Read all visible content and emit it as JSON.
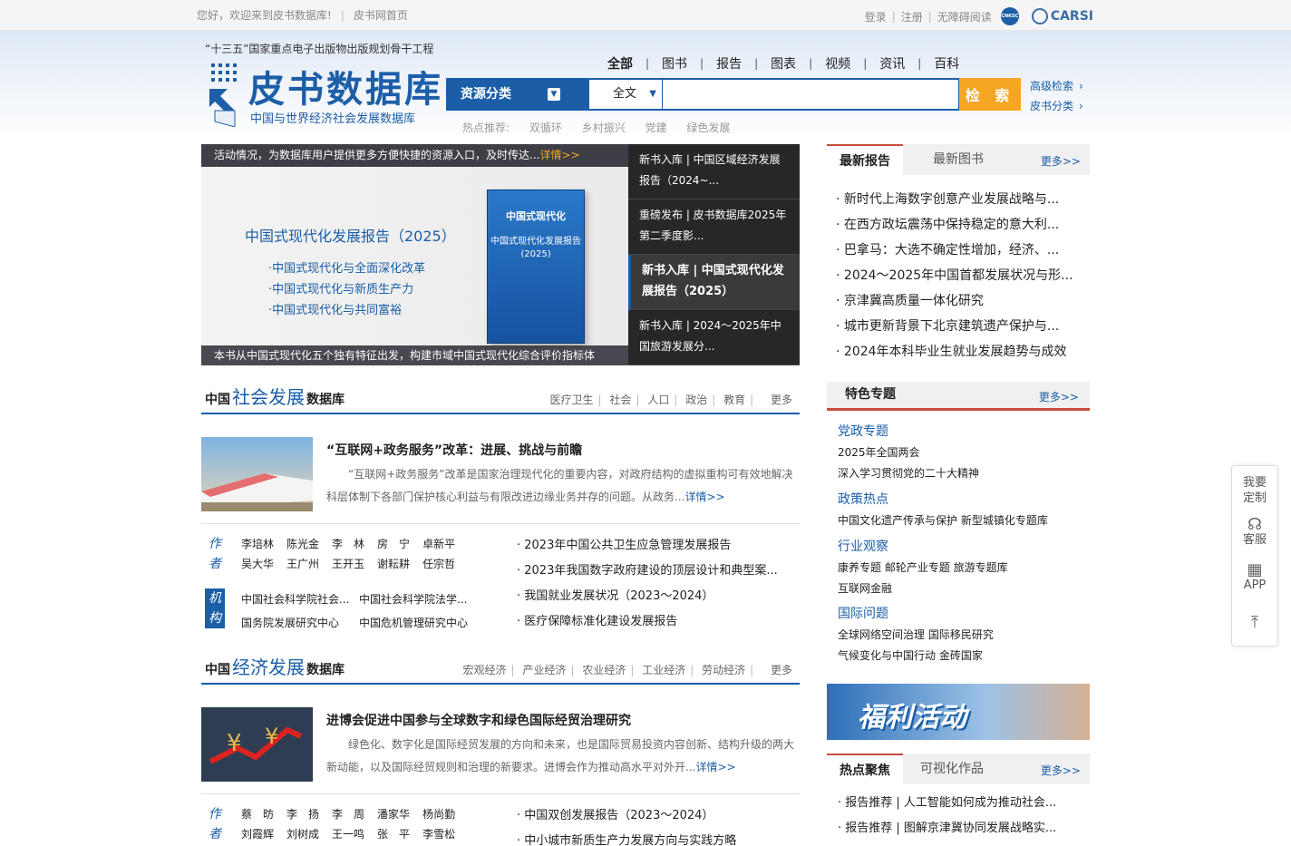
{
  "topbar": {
    "welcome": "您好，欢迎来到皮书数据库!",
    "home_link": "皮书网首页",
    "login": "登录",
    "register": "注册",
    "accessible": "无障碍阅读",
    "carsi_label": "CARSI",
    "circle_logo": "CNKSC"
  },
  "header": {
    "slogan": "“十三五”国家重点电子出版物出版规划骨干工程",
    "logo_title": "皮书数据库",
    "logo_sub": "中国与世界经济社会发展数据库"
  },
  "search": {
    "tabs": [
      "全部",
      "图书",
      "报告",
      "图表",
      "视频",
      "资讯",
      "百科"
    ],
    "active_tab": "全部",
    "category_label": "资源分类",
    "field_value": "全文",
    "input_value": "",
    "button_label": "检 索",
    "advanced": "高级检索",
    "classify": "皮书分类",
    "hot_label": "热点推荐:",
    "hot_keywords": [
      "双循环",
      "乡村振兴",
      "党建",
      "绿色发展"
    ]
  },
  "banner": {
    "top_text": "活动情况，为数据库用户提供更多方便快捷的资源入口，及时传达...",
    "top_more": "详情>>",
    "title": "中国式现代化发展报告（2025）",
    "bullets": [
      "·中国式现代化与全面深化改革",
      "·中国式现代化与新质生产力",
      "·中国式现代化与共同富裕"
    ],
    "book_title": "中国式现代化",
    "book_sub": "中国式现代化发展报告(2025)",
    "bottom_text": "本书从中国式现代化五个独有特征出发，构建市域中国式现代化综合评价指标体"
  },
  "side_news": [
    "新书入库 | 中国区域经济发展报告（2024~...",
    "重磅发布 | 皮书数据库2025年第二季度影...",
    "新书入库 | 中国式现代化发展报告（2025）",
    "新书入库 | 2024～2025年中国旅游发展分..."
  ],
  "social": {
    "title_pre": "中国",
    "title_big": "社会发展",
    "title_post": "数据库",
    "cats": [
      "医疗卫生",
      "社会",
      "人口",
      "政治",
      "教育"
    ],
    "more": "更多",
    "feature_title": "“互联网+政务服务”改革：进展、挑战与前瞻",
    "feature_desc": "“互联网+政务服务”改革是国家治理现代化的重要内容，对政府结构的虚拟重构可有效地解决科层体制下各部门保护核心利益与有限改进边缘业务并存的问题。从政务...",
    "feature_more": "详情>>",
    "author_tag": "作者",
    "authors_row1": [
      "李培林",
      "陈光金",
      "李　林",
      "房　宁",
      "卓新平"
    ],
    "authors_row2": [
      "吴大华",
      "王广州",
      "王开玉",
      "谢耘耕",
      "任宗哲"
    ],
    "org_tag": "机构",
    "orgs_row1": [
      "中国社会科学院社会...",
      "中国社会科学院法学..."
    ],
    "orgs_row2": [
      "国务院发展研究中心",
      "中国危机管理研究中心"
    ],
    "reports": [
      "2023年中国公共卫生应急管理发展报告",
      "2023年我国数字政府建设的顶层设计和典型案...",
      "我国就业发展状况（2023～2024）",
      "医疗保障标准化建设发展报告"
    ]
  },
  "economy": {
    "title_pre": "中国",
    "title_big": "经济发展",
    "title_post": "数据库",
    "cats": [
      "宏观经济",
      "产业经济",
      "农业经济",
      "工业经济",
      "劳动经济"
    ],
    "more": "更多",
    "feature_title": "进博会促进中国参与全球数字和绿色国际经贸治理研究",
    "feature_desc": "绿色化、数字化是国际经贸发展的方向和未来，也是国际贸易投资内容创新、结构升级的两大新动能，以及国际经贸规则和治理的新要求。进博会作为推动高水平对外开...",
    "feature_more": "详情>>",
    "author_tag": "作者",
    "authors_row1": [
      "蔡　昉",
      "李　扬",
      "李　周",
      "潘家华",
      "杨尚勤"
    ],
    "authors_row2": [
      "刘霞辉",
      "刘树成",
      "王一鸣",
      "张　平",
      "李雪松"
    ],
    "reports": [
      "中国双创发展报告（2023～2024）",
      "中小城市新质生产力发展方向与实践方略"
    ]
  },
  "latest": {
    "tab_reports": "最新报告",
    "tab_books": "最新图书",
    "more": "更多>>",
    "items": [
      "新时代上海数字创意产业发展战略与...",
      "在西方政坛震荡中保持稳定的意大利...",
      "巴拿马：大选不确定性增加，经济、...",
      "2024～2025年中国首都发展状况与形...",
      "京津冀高质量一体化研究",
      "城市更新背景下北京建筑遗产保护与...",
      "2024年本科毕业生就业发展趋势与成效"
    ]
  },
  "special": {
    "title": "特色专题",
    "more": "更多>>",
    "groups": [
      {
        "head": "党政专题",
        "lines": [
          "2025年全国两会",
          "深入学习贯彻党的二十大精神"
        ]
      },
      {
        "head": "政策热点",
        "lines": [
          "中国文化遗产传承与保护 新型城镇化专题库"
        ]
      },
      {
        "head": "行业观察",
        "lines": [
          "康养专题 邮轮产业专题 旅游专题库",
          "互联网金融"
        ]
      },
      {
        "head": "国际问题",
        "lines": [
          "全球网络空间治理 国际移民研究",
          "气候变化与中国行动 金砖国家"
        ]
      }
    ]
  },
  "promo": {
    "text": "福利活动"
  },
  "hot_focus": {
    "tab_hot": "热点聚焦",
    "tab_vis": "可视化作品",
    "more": "更多>>",
    "items": [
      "报告推荐 | 人工智能如何成为推动社会...",
      "报告推荐 | 图解京津冀协同发展战略实..."
    ]
  },
  "floatbar": {
    "custom": "我要定制",
    "service": "客服",
    "app": "APP",
    "top_icon": "back-to-top-icon"
  },
  "colors": {
    "brand": "#1b5ea7",
    "accent": "#f5a623",
    "red": "#c84b3d"
  }
}
